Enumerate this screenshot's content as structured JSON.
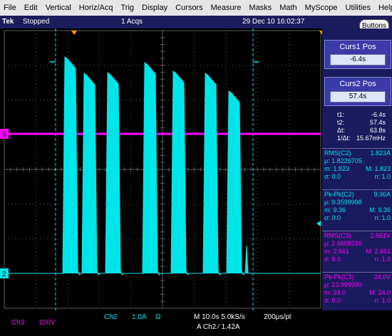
{
  "menu": [
    "File",
    "Edit",
    "Vertical",
    "Horiz/Acq",
    "Trig",
    "Display",
    "Cursors",
    "Measure",
    "Masks",
    "Math",
    "MyScope",
    "Utilities",
    "Help"
  ],
  "status": {
    "brand": "Tek",
    "state": "Stopped",
    "acqs": "1 Acqs",
    "datetime": "29 Dec 10 16:02:37",
    "buttons_label": "Buttons"
  },
  "markers": {
    "ch3": "3",
    "ch2": "2"
  },
  "colors": {
    "ch2": "#00e5ea",
    "ch3": "#ff00ff",
    "grid": "#5c5c5c",
    "panel": "#1a1a5e"
  },
  "cursors": {
    "curs1": {
      "title": "Curs1 Pos",
      "value": "-6.4s"
    },
    "curs2": {
      "title": "Curs2 Pos",
      "value": "57.4s"
    },
    "readout": [
      {
        "k": "t1:",
        "v": "-6.4s"
      },
      {
        "k": "t2:",
        "v": "57.4s"
      },
      {
        "k": "Δt:",
        "v": "63.8s"
      },
      {
        "k": "1/Δt:",
        "v": "15.67mHz"
      }
    ]
  },
  "measurements": [
    {
      "name": "RMS(C2)",
      "value": "1.823A",
      "mean": "μ: 1.8226705",
      "min": "m: 1.823",
      "max": "M: 1.823",
      "sigma": "σ: 0.0",
      "n": "n: 1.0",
      "color": "#00e5ea"
    },
    {
      "name": "Pk-Pk(C2)",
      "value": "9.36A",
      "mean": "μ: 9.3599998",
      "min": "m: 9.36",
      "max": "M: 9.36",
      "sigma": "σ: 0.0",
      "n": "n: 1.0",
      "color": "#00e5ea"
    },
    {
      "name": "RMS(C3)",
      "value": "2.661V",
      "mean": "μ: 2.6608316",
      "min": "m: 2.661",
      "max": "M: 2.661",
      "sigma": "σ: 0.0",
      "n": "n: 1.0",
      "color": "#ff00ff"
    },
    {
      "name": "Pk-Pk(C3)",
      "value": "24.0V",
      "mean": "μ: 23.999999",
      "min": "m: 24.0",
      "max": "M: 24.0",
      "sigma": "σ: 0.0",
      "n": "n: 1.0",
      "color": "#ff00ff"
    }
  ],
  "bottom": {
    "ch3_label": "Ch3",
    "ch3_scale": "100V",
    "ch2_label": "Ch2",
    "ch2_scale": "1.0A",
    "ch2_coupling": "Ω",
    "timebase": "M 10.0s 5.0kS/s",
    "resolution": "200μs/pt",
    "trigger": "A  Ch2  ⁄  1.42A"
  }
}
